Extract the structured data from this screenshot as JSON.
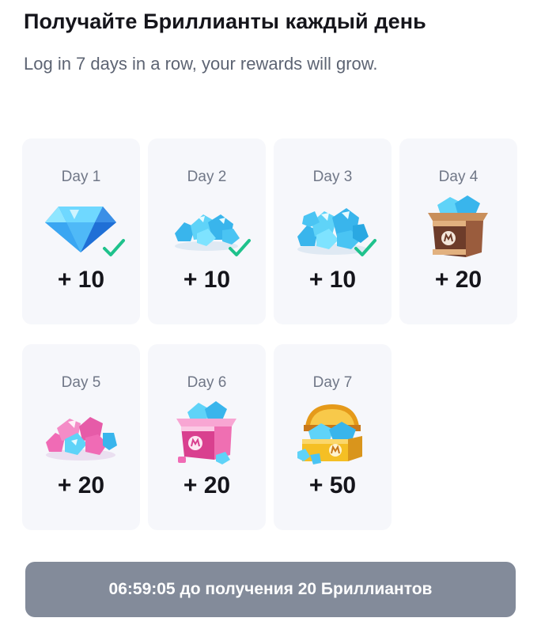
{
  "header": {
    "title": "Получайте Бриллианты каждый день",
    "subtitle": "Log in 7 days in a row, your rewards will grow."
  },
  "rewards": [
    {
      "day": "Day 1",
      "amount": "+ 10",
      "claimed": true,
      "icon": "single-diamond-icon"
    },
    {
      "day": "Day 2",
      "amount": "+ 10",
      "claimed": true,
      "icon": "small-diamond-pile-icon"
    },
    {
      "day": "Day 3",
      "amount": "+ 10",
      "claimed": true,
      "icon": "diamond-pile-icon"
    },
    {
      "day": "Day 4",
      "amount": "+ 20",
      "claimed": false,
      "icon": "diamond-box-icon"
    },
    {
      "day": "Day 5",
      "amount": "+ 20",
      "claimed": false,
      "icon": "pink-diamond-pile-icon"
    },
    {
      "day": "Day 6",
      "amount": "+ 20",
      "claimed": false,
      "icon": "pink-diamond-box-icon"
    },
    {
      "day": "Day 7",
      "amount": "+ 50",
      "claimed": false,
      "icon": "treasure-chest-icon"
    }
  ],
  "timer": {
    "label": "06:59:05 до получения 20 Бриллиантов"
  },
  "colors": {
    "card_bg": "#f6f7fb",
    "check_green": "#1fc28c",
    "button_bg": "#838b9a",
    "diamond_blue": "#4fc9f1",
    "gem_pink": "#f06bb5",
    "box_brown": "#7d4a34",
    "chest_gold": "#f5bf24"
  }
}
